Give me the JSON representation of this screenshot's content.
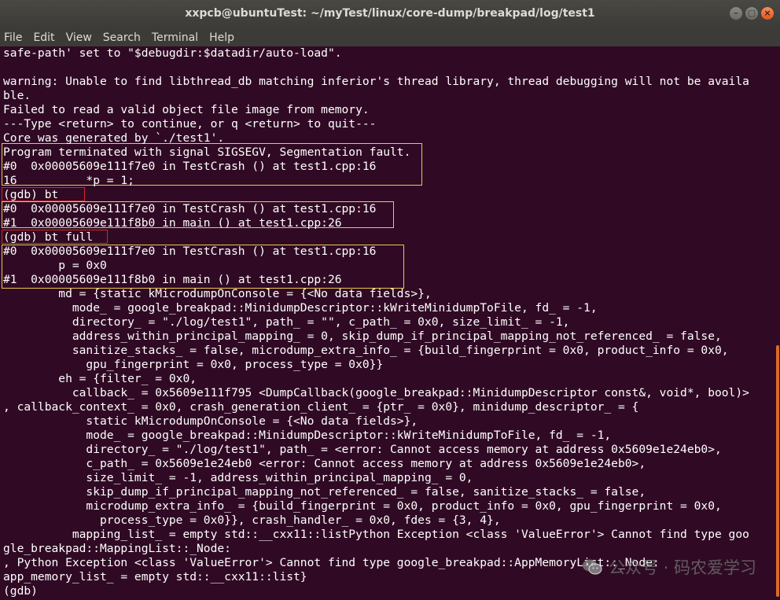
{
  "window": {
    "title": "xxpcb@ubuntuTest: ~/myTest/linux/core-dump/breakpad/log/test1",
    "buttons": [
      "–",
      "▢",
      "×"
    ]
  },
  "menu": [
    "File",
    "Edit",
    "View",
    "Search",
    "Terminal",
    "Help"
  ],
  "lines": [
    "safe-path' set to \"$debugdir:$datadir/auto-load\".",
    "",
    "warning: Unable to find libthread_db matching inferior's thread library, thread debugging will not be availa",
    "ble.",
    "Failed to read a valid object file image from memory.",
    "---Type <return> to continue, or q <return> to quit---",
    "Core was generated by `./test1'.",
    "Program terminated with signal SIGSEGV, Segmentation fault.",
    "#0  0x00005609e111f7e0 in TestCrash () at test1.cpp:16",
    "16          *p = 1;",
    "(gdb) bt",
    "#0  0x00005609e111f7e0 in TestCrash () at test1.cpp:16",
    "#1  0x00005609e111f8b0 in main () at test1.cpp:26",
    "(gdb) bt full",
    "#0  0x00005609e111f7e0 in TestCrash () at test1.cpp:16",
    "        p = 0x0",
    "#1  0x00005609e111f8b0 in main () at test1.cpp:26",
    "        md = {static kMicrodumpOnConsole = {<No data fields>},",
    "          mode_ = google_breakpad::MinidumpDescriptor::kWriteMinidumpToFile, fd_ = -1,",
    "          directory_ = \"./log/test1\", path_ = \"\", c_path_ = 0x0, size_limit_ = -1,",
    "          address_within_principal_mapping_ = 0, skip_dump_if_principal_mapping_not_referenced_ = false,",
    "          sanitize_stacks_ = false, microdump_extra_info_ = {build_fingerprint = 0x0, product_info = 0x0,",
    "            gpu_fingerprint = 0x0, process_type = 0x0}}",
    "        eh = {filter_ = 0x0,",
    "          callback_ = 0x5609e111f795 <DumpCallback(google_breakpad::MinidumpDescriptor const&, void*, bool)>",
    ", callback_context_ = 0x0, crash_generation_client_ = {ptr_ = 0x0}, minidump_descriptor_ = {",
    "            static kMicrodumpOnConsole = {<No data fields>},",
    "            mode_ = google_breakpad::MinidumpDescriptor::kWriteMinidumpToFile, fd_ = -1,",
    "            directory_ = \"./log/test1\", path_ = <error: Cannot access memory at address 0x5609e1e24eb0>,",
    "            c_path_ = 0x5609e1e24eb0 <error: Cannot access memory at address 0x5609e1e24eb0>,",
    "            size_limit_ = -1, address_within_principal_mapping_ = 0,",
    "            skip_dump_if_principal_mapping_not_referenced_ = false, sanitize_stacks_ = false,",
    "            microdump_extra_info_ = {build_fingerprint = 0x0, product_info = 0x0, gpu_fingerprint = 0x0,",
    "              process_type = 0x0}}, crash_handler_ = 0x0, fdes = {3, 4},",
    "          mapping_list_ = empty std::__cxx11::listPython Exception <class 'ValueError'> Cannot find type goo",
    "gle_breakpad::MappingList::_Node:",
    ", Python Exception <class 'ValueError'> Cannot find type google_breakpad::AppMemoryList::_Node:",
    "app_memory_list_ = empty std::__cxx11::list}",
    "(gdb)"
  ],
  "watermark": {
    "text": "公众号 · 码农爱学习",
    "icon": "wechat-icon"
  },
  "colors": {
    "background": "#300a24",
    "text": "#ffffff",
    "highlight_yellow": "#e9c94c",
    "highlight_red": "#d02828"
  }
}
